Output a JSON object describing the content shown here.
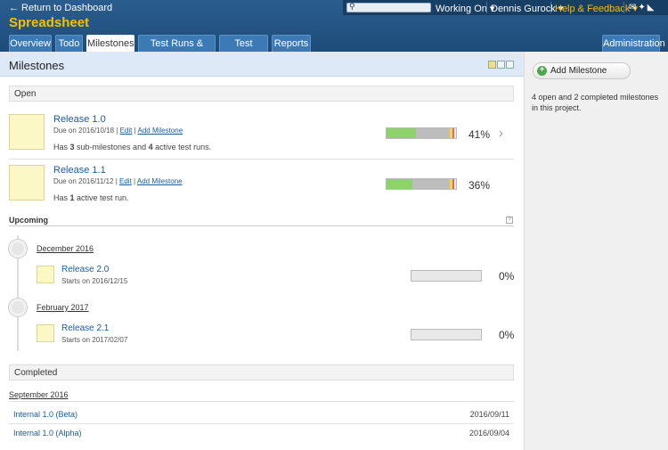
{
  "header": {
    "return_label": "← Return to Dashboard",
    "project_name": "Spreadsheet",
    "search_placeholder": "",
    "working_on": "Working On ▾",
    "user": "Dennis Gurock ▾",
    "help": "Help & Feedback ▾",
    "icons": [
      "mail-icon",
      "twitter-icon",
      "rss-icon"
    ]
  },
  "tabs": [
    {
      "label": "Overview"
    },
    {
      "label": "Todo"
    },
    {
      "label": "Milestones"
    },
    {
      "label": "Test Runs & Results"
    },
    {
      "label": "Test Cases"
    },
    {
      "label": "Reports"
    },
    {
      "label": "Administration"
    }
  ],
  "page_title": "Milestones",
  "open_label": "Open",
  "open_milestones": [
    {
      "name": "Release 1.0",
      "due": "Due on 2016/10/18",
      "edit": "Edit",
      "add": "Add Milestone",
      "desc_prefix": "Has ",
      "desc_n1": "3",
      "desc_mid": " sub-milestones and ",
      "desc_n2": "4",
      "desc_suffix": " active test runs.",
      "percent": "41%",
      "progress": {
        "passed": 0.41,
        "untested": 0.47,
        "retest": 0.04,
        "failed": 0.03
      }
    },
    {
      "name": "Release 1.1",
      "due": "Due on 2016/11/12",
      "edit": "Edit",
      "add": "Add Milestone",
      "desc_prefix": "Has ",
      "desc_n1": "1",
      "desc_suffix": " active test run.",
      "percent": "36%",
      "progress": {
        "passed": 0.36,
        "untested": 0.52,
        "retest": 0.04,
        "failed": 0.03
      }
    }
  ],
  "upcoming_label": "Upcoming",
  "upcoming": [
    {
      "month": "December 2016",
      "name": "Release 2.0",
      "start": "Starts on 2016/12/15",
      "percent": "0%"
    },
    {
      "month": "February 2017",
      "name": "Release 2.1",
      "start": "Starts on 2017/02/07",
      "percent": "0%"
    }
  ],
  "completed_label": "Completed",
  "completed_month": "September 2016",
  "completed": [
    {
      "name": "Internal 1.0 (Beta)",
      "date": "2016/09/11"
    },
    {
      "name": "Internal 1.0 (Alpha)",
      "date": "2016/09/04"
    }
  ],
  "sidebar": {
    "add_milestone": "Add Milestone",
    "summary": "4 open and 2 completed milestones in this project."
  }
}
